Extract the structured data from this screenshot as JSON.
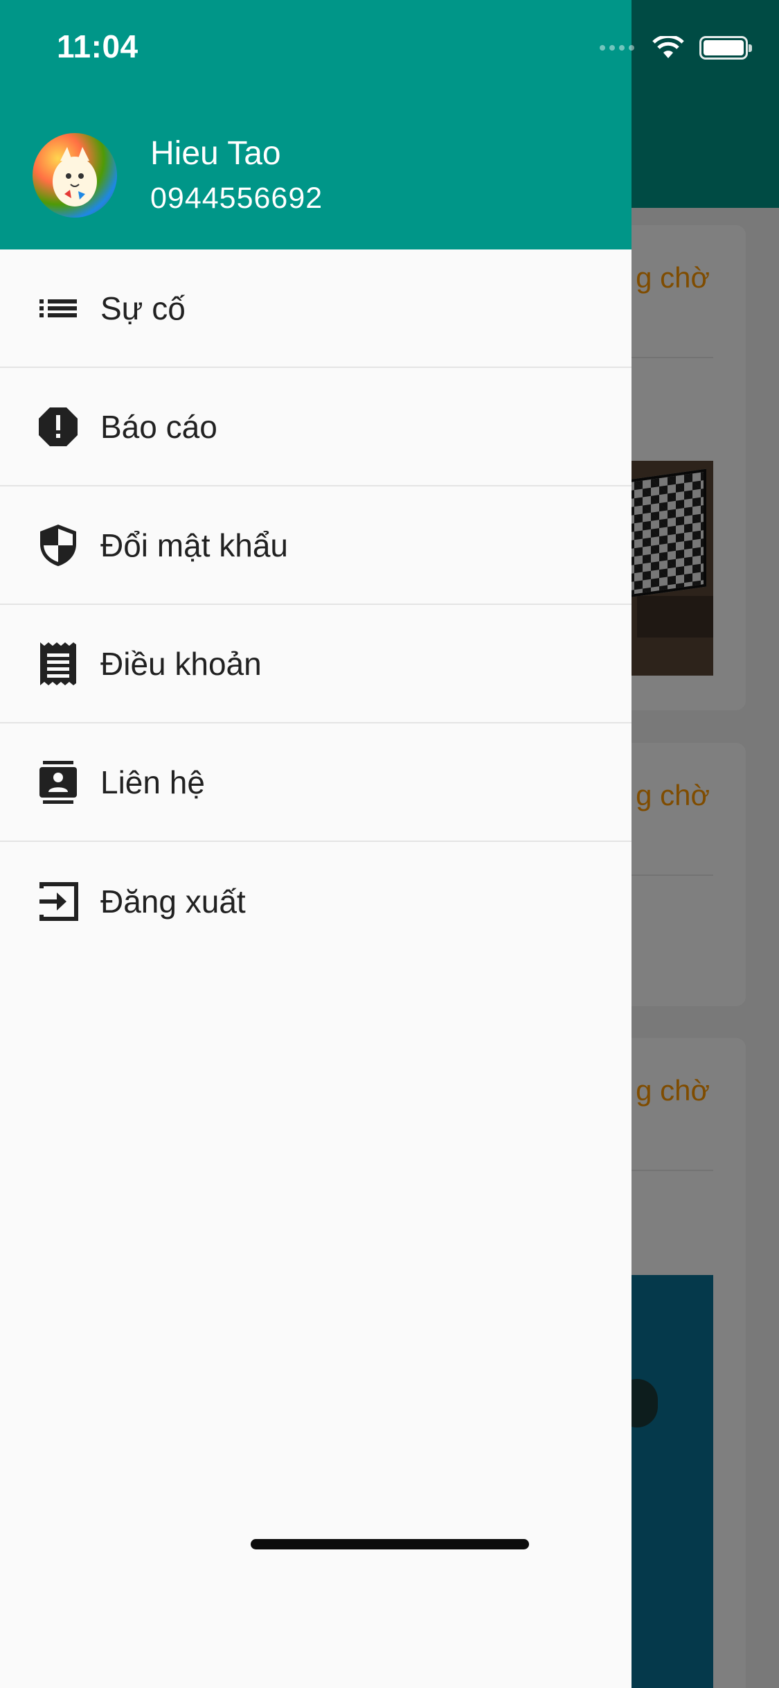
{
  "status_bar": {
    "time": "11:04"
  },
  "user": {
    "name": "Hieu Tao",
    "phone": "0944556692"
  },
  "menu": {
    "items": [
      {
        "label": "Sự cố",
        "icon": "list-icon"
      },
      {
        "label": "Báo cáo",
        "icon": "report-icon"
      },
      {
        "label": "Đổi mật khẩu",
        "icon": "shield-icon"
      },
      {
        "label": "Điều khoản",
        "icon": "receipt-icon"
      },
      {
        "label": "Liên hệ",
        "icon": "contact-icon"
      },
      {
        "label": "Đăng xuất",
        "icon": "logout-icon"
      }
    ]
  },
  "background": {
    "cards": [
      {
        "status": "g chờ"
      },
      {
        "status": "g chờ"
      },
      {
        "status": "g chờ"
      }
    ]
  },
  "colors": {
    "primary": "#009688",
    "status_text": "#ff9800",
    "drawer_bg": "#fafafa",
    "text": "#212121"
  }
}
